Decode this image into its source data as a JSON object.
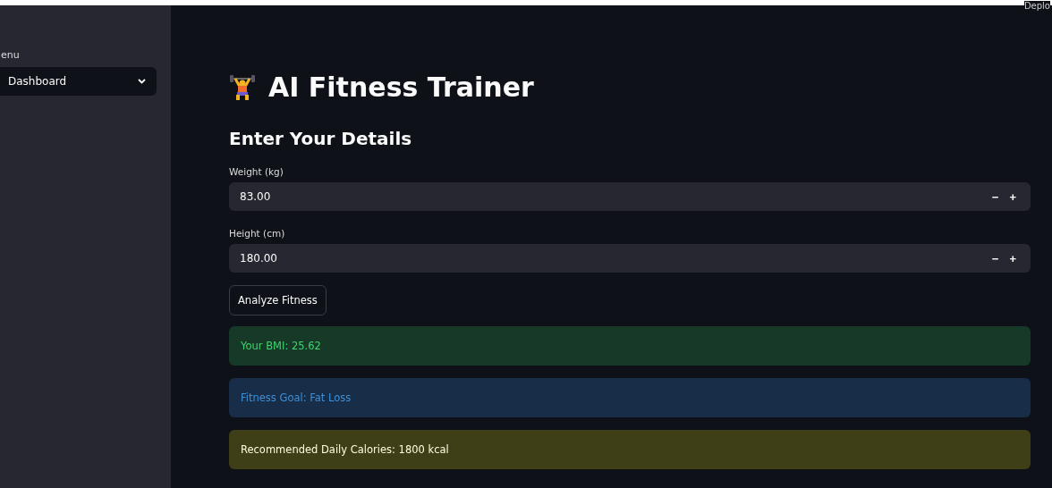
{
  "header": {
    "deploy": "Deplo"
  },
  "sidebar": {
    "label": "enu",
    "select": {
      "value": "Dashboard"
    }
  },
  "title": "AI Fitness Trainer",
  "subheading": "Enter Your Details",
  "inputs": [
    {
      "label": "Weight (kg)",
      "value": "83.00",
      "minus": "−",
      "plus": "+"
    },
    {
      "label": "Height (cm)",
      "value": "180.00",
      "minus": "−",
      "plus": "+"
    }
  ],
  "button": "Analyze Fitness",
  "alerts": [
    {
      "kind": "success",
      "text": "Your BMI: 25.62"
    },
    {
      "kind": "info",
      "text": "Fitness Goal: Fat Loss"
    },
    {
      "kind": "warning",
      "text": "Recommended Daily Calories: 1800 kcal"
    }
  ]
}
